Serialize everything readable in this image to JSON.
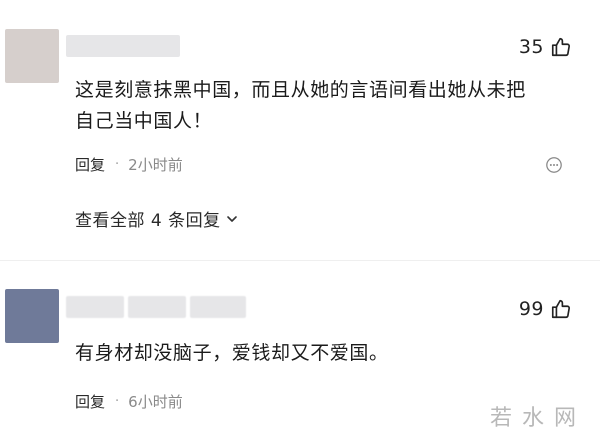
{
  "comments": [
    {
      "avatar_color": "#d6cfcc",
      "likes": "35",
      "text_line1": "这是刻意抹黑中国，而且从她的言语间看出她从未把",
      "text_line2": "自己当中国人！",
      "reply_label": "回复",
      "separator": "·",
      "time": "2小时前",
      "view_replies": "查看全部 4 条回复"
    },
    {
      "avatar_color": "#6f7a99",
      "likes": "99",
      "text_line1": "有身材却没脑子，爱钱却又不爱国。",
      "reply_label": "回复",
      "separator": "·",
      "time": "6小时前"
    }
  ],
  "watermark": "若水网",
  "icons": {
    "like": "thumbs-up-icon",
    "more": "more-dots-icon",
    "expand": "chevron-down-icon"
  }
}
